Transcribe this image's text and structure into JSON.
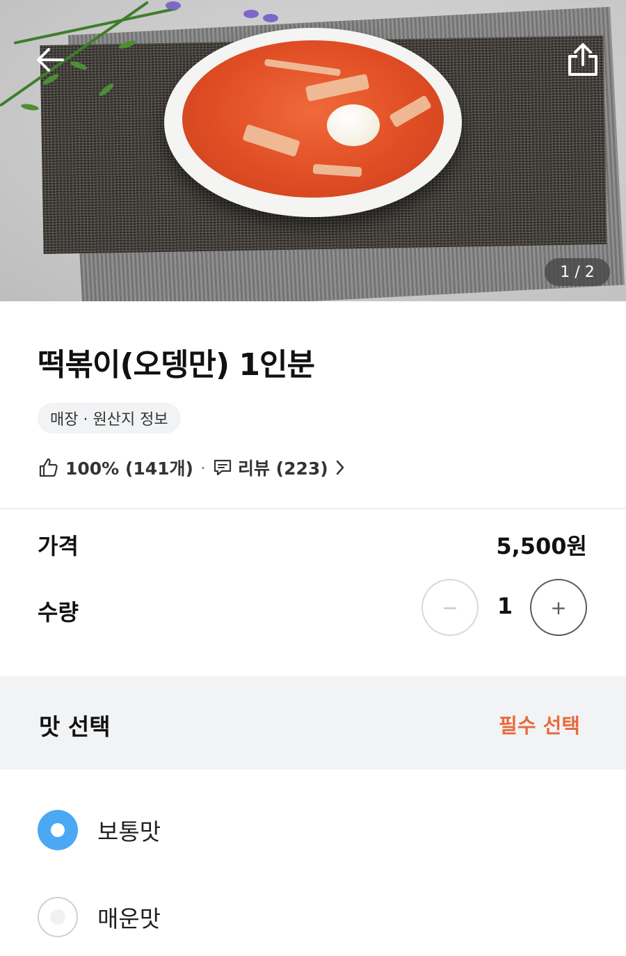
{
  "hero": {
    "image_counter": "1 / 2",
    "back_icon": "arrow-left-icon",
    "share_icon": "share-icon"
  },
  "product": {
    "title": "떡볶이(오뎅만) 1인분",
    "origin_chip": "매장 · 원산지 정보",
    "rating_percent": "100% (141개)",
    "separator": "·",
    "review_label": "리뷰 (223)"
  },
  "order": {
    "price_label": "가격",
    "price_value": "5,500원",
    "quantity_label": "수량",
    "quantity_value": "1",
    "minus_symbol": "−",
    "plus_symbol": "+"
  },
  "taste": {
    "section_title": "맛 선택",
    "required_label": "필수 선택",
    "options": [
      {
        "label": "보통맛",
        "selected": true
      },
      {
        "label": "매운맛",
        "selected": false
      }
    ]
  },
  "colors": {
    "accent_blue": "#4aa8f5",
    "required_orange": "#e86b3c"
  }
}
